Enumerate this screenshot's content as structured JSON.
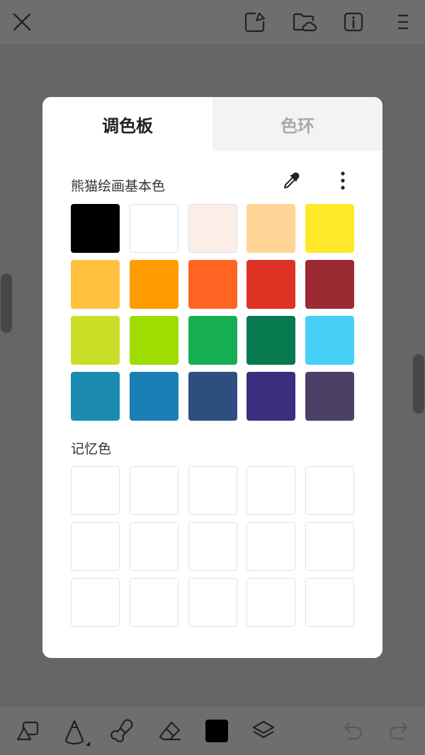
{
  "toolbar_top": {
    "icons": [
      "close-icon",
      "export-image-icon",
      "cloud-folder-icon",
      "info-icon",
      "menu-icon"
    ]
  },
  "palette_dialog": {
    "tabs": [
      {
        "label": "调色板",
        "active": true
      },
      {
        "label": "色环",
        "active": false
      }
    ],
    "basic_colors": {
      "title": "熊猫绘画基本色",
      "icons": [
        "eyedropper-icon",
        "more-vertical-icon"
      ],
      "colors": [
        "#000000",
        "#ffffff",
        "#fbeee6",
        "#ffd496",
        "#ffe82a",
        "#ffc13d",
        "#ff9c00",
        "#ff6422",
        "#de3224",
        "#9b2a33",
        "#c9df27",
        "#9fdc00",
        "#17ad52",
        "#06794e",
        "#46d0f8",
        "#1c8bb2",
        "#197fb5",
        "#2e4e7f",
        "#3c2e7e",
        "#4b4167"
      ]
    },
    "memory_colors": {
      "title": "记忆色",
      "slot_count": 15
    }
  },
  "toolbar_bottom": {
    "icons": [
      "shapes-icon",
      "pencil-icon",
      "brush-icon",
      "eraser-icon",
      "current-color-icon",
      "layers-icon",
      "undo-icon",
      "redo-icon"
    ],
    "current_color": "#000000"
  }
}
